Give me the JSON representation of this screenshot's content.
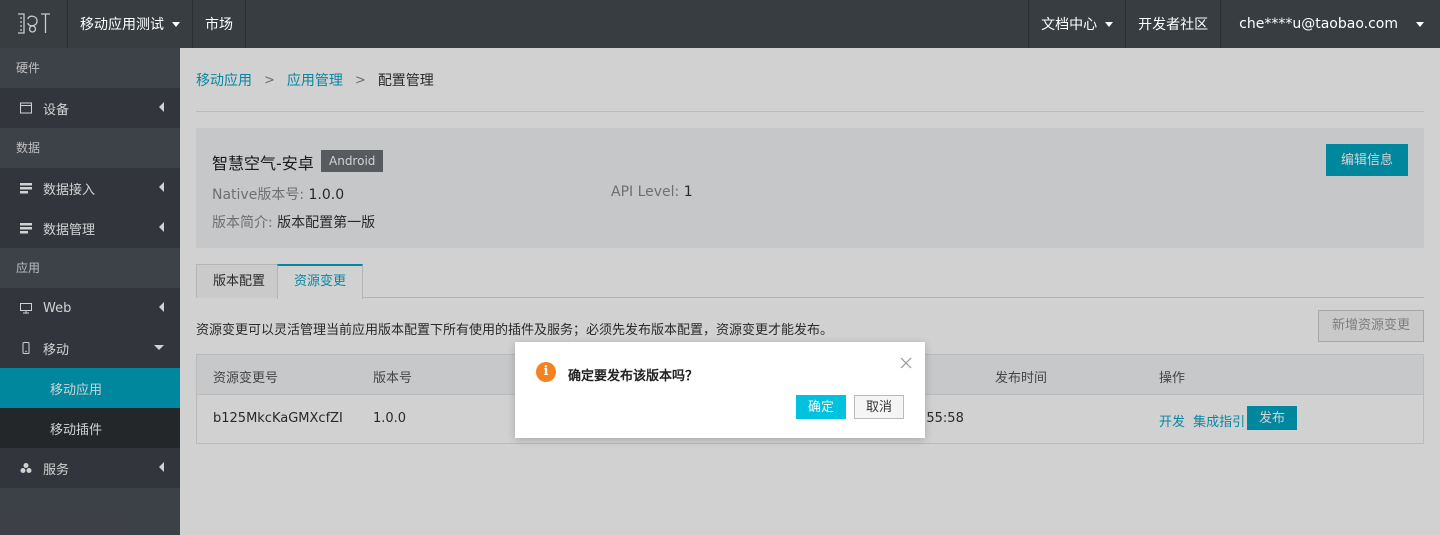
{
  "topbar": {
    "project_label": "移动应用测试",
    "market_label": "市场",
    "docs_label": "文档中心",
    "community_label": "开发者社区",
    "user_label": "che****u@taobao.com"
  },
  "sidebar": {
    "groups": {
      "hardware": "硬件",
      "data": "数据",
      "app": "应用"
    },
    "items": {
      "device": "设备",
      "data_access": "数据接入",
      "data_manage": "数据管理",
      "web": "Web",
      "mobile": "移动",
      "mobile_app": "移动应用",
      "mobile_plugin": "移动插件",
      "service": "服务"
    }
  },
  "breadcrumb": {
    "level1": "移动应用",
    "level2": "应用管理",
    "current": "配置管理",
    "separator": ">"
  },
  "app_info": {
    "name": "智慧空气-安卓",
    "platform": "Android",
    "edit_label": "编辑信息",
    "native_version_label": "Native版本号:",
    "native_version": "1.0.0",
    "api_level_label": "API Level:",
    "api_level": "1",
    "desc_label": "版本简介:",
    "desc": "版本配置第一版"
  },
  "tabs": [
    {
      "label": "版本配置",
      "active": false
    },
    {
      "label": "资源变更",
      "active": true
    }
  ],
  "resource": {
    "description": "资源变更可以灵活管理当前应用版本配置下所有使用的插件及服务；必须先发布版本配置，资源变更才能发布。",
    "add_label": "新增资源变更",
    "columns": [
      "资源变更号",
      "版本号",
      "发布时间",
      "操作"
    ],
    "rows": [
      {
        "id": "b125MkcKaGMXcfZI",
        "version": "1.0.0",
        "publish_time_partial": ":55:58",
        "ops": [
          "开发",
          "集成指引"
        ],
        "publish_label": "发布"
      }
    ]
  },
  "dialog": {
    "message": "确定要发布该版本吗？",
    "ok_label": "确定",
    "cancel_label": "取消",
    "icon_glyph": "i"
  },
  "colors": {
    "accent": "#00a5c1",
    "topbar": "#373d41",
    "sidebar": "#4a4f57",
    "warning": "#f5821f"
  }
}
